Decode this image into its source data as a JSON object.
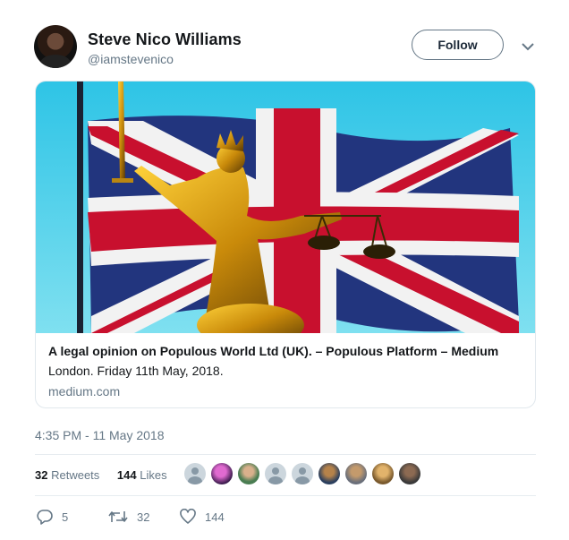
{
  "author": {
    "name": "Steve Nico Williams",
    "handle": "@iamstevenico",
    "follow_label": "Follow"
  },
  "card": {
    "title": "A legal opinion on Populous World Ltd (UK). – Populous Platform – Medium",
    "description": "London. Friday 11th May, 2018.",
    "domain": "medium.com"
  },
  "timestamp": "4:35 PM - 11 May 2018",
  "stats": {
    "retweets_count": "32",
    "retweets_label": "Retweets",
    "likes_count": "144",
    "likes_label": "Likes",
    "liker_avatar_count": 9
  },
  "actions": {
    "reply_count": "5",
    "retweet_count": "32",
    "like_count": "144"
  },
  "colors": {
    "text": "#14171a",
    "secondary": "#657786",
    "border": "#e1e8ed"
  },
  "icons": [
    "chevron-down-icon",
    "reply-icon",
    "retweet-icon",
    "like-icon"
  ]
}
